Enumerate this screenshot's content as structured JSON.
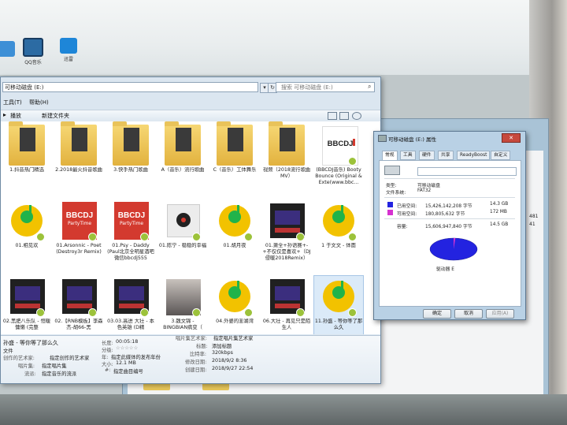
{
  "desktop": {
    "icons": [
      {
        "label": "QQ音乐"
      },
      {
        "label": "迅雷"
      }
    ]
  },
  "explorer": {
    "address": "可移动磁盘 (E:)",
    "search_placeholder": "搜索 可移动磁盘 (E:)",
    "menu": [
      "工具(T)",
      "帮助(H)"
    ],
    "toolbar": {
      "play": "播放",
      "new_folder": "新建文件夹"
    },
    "items": [
      {
        "label": "1.抖音热门精选",
        "kind": "folder"
      },
      {
        "label": "2.2018最火抖音歌曲",
        "kind": "folder"
      },
      {
        "label": "3.快手热门歌曲",
        "kind": "folder"
      },
      {
        "label": "A（音乐）流行歌曲",
        "kind": "folder"
      },
      {
        "label": "C（音乐）工体舞乐",
        "kind": "folder"
      },
      {
        "label": "视频（2018流行歌曲MV）",
        "kind": "folder"
      },
      {
        "label": "(BBCDJ音乐) Booty Bounce (Original & Exte(www.bbc...",
        "kind": "bbc-white"
      },
      {
        "label": "01.相见欢",
        "kind": "qq"
      },
      {
        "label": "01.Arsonnic - Poet (Destroy3r Remix)",
        "kind": "bbc"
      },
      {
        "label": "01.Psy - Daddy (Paul北京全明星酒吧微信bbcdj555",
        "kind": "bbc"
      },
      {
        "label": "01.陈宁 - 稳稳的幸福",
        "kind": "disc"
      },
      {
        "label": "01.胡月夜",
        "kind": "qq"
      },
      {
        "label": "01.萧全+孙语赛+-+不仅仅是喜欢+（DJ侵暖2018Remix）",
        "kind": "car"
      },
      {
        "label": "1 于文文 - 体面",
        "kind": "qq"
      },
      {
        "label": "02.黑肥八乐队 - 恒暖慵懒 (完整",
        "kind": "car"
      },
      {
        "label": "02.【RNB模板】李森杰-胡66-黑",
        "kind": "car"
      },
      {
        "label": "03.03.高进 大壮 - 本色英雄 (D精",
        "kind": "car"
      },
      {
        "label": "3.魏文锦 - BINGBIAN病变（",
        "kind": "photo"
      },
      {
        "label": "04.外婆的澎湖湾",
        "kind": "qq"
      },
      {
        "label": "06.大壮 - 再见只是陌生人",
        "kind": "car"
      },
      {
        "label": "11.孙盛 - 等你等了那么久",
        "kind": "qq"
      }
    ],
    "details": {
      "filename": "孙盛 - 等你等了那么久",
      "filetype": "文件",
      "rows_left": [
        {
          "k": "创作的艺术家:",
          "v": "指定创作的艺术家"
        },
        {
          "k": "唱片集:",
          "v": "指定唱片集"
        },
        {
          "k": "流派:",
          "v": "指定音乐的流派"
        }
      ],
      "rows_mid": [
        {
          "k": "长度:",
          "v": "00:05:18"
        },
        {
          "k": "分级:",
          "v": "☆☆☆☆☆"
        },
        {
          "k": "年:",
          "v": "指定此媒体的发布年份"
        },
        {
          "k": "大小:",
          "v": "12.1 MB"
        },
        {
          "k": "#:",
          "v": "指定曲目编号"
        }
      ],
      "rows_right": [
        {
          "k": "唱片集艺术家:",
          "v": "指定唱片集艺术家"
        },
        {
          "k": "标题:",
          "v": "添加标题"
        },
        {
          "k": "比特率:",
          "v": "320kbps"
        },
        {
          "k": "修改日期:",
          "v": "2018/9/2 8:36"
        },
        {
          "k": "创建日期:",
          "v": "2018/9/27 22:54"
        }
      ]
    }
  },
  "properties": {
    "title": "可移动磁盘 (E:) 属性",
    "close": "✕",
    "tabs": [
      "常规",
      "工具",
      "硬件",
      "共享",
      "ReadyBoost",
      "自定义"
    ],
    "type_label": "类型:",
    "type_value": "可移动磁盘",
    "fs_label": "文件系统:",
    "fs_value": "FAT32",
    "used_label": "已用空间:",
    "used_bytes": "15,426,142,208 字节",
    "used_gb": "14.3 GB",
    "free_label": "可用空间:",
    "free_bytes": "180,805,632 字节",
    "free_mb": "172 MB",
    "cap_label": "容量:",
    "cap_bytes": "15,606,947,840 字节",
    "cap_gb": "14.5 GB",
    "drive_label": "驱动器 E",
    "used_fraction": 0.988,
    "colors": {
      "used": "#2323e0",
      "free": "#d631d0"
    },
    "buttons": {
      "ok": "确定",
      "cancel": "取消"
    }
  },
  "background_window": {
    "side_text": [
      "481",
      "41"
    ]
  }
}
